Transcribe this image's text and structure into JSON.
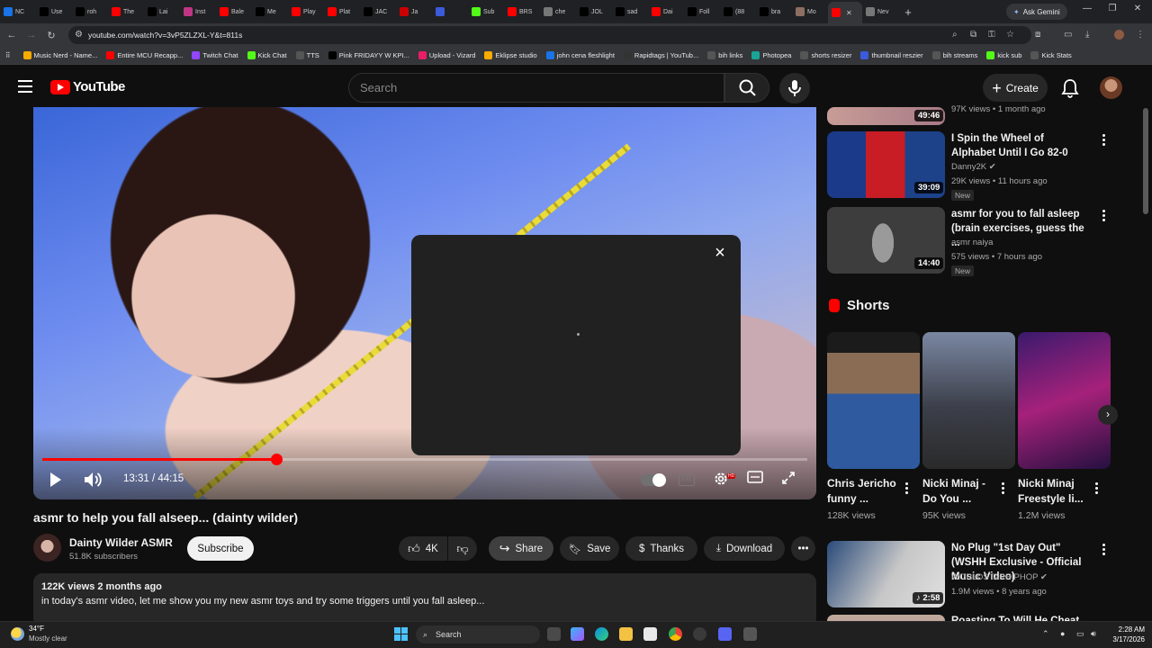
{
  "browser": {
    "tabs": [
      {
        "label": "NC",
        "color": "#1a73e8"
      },
      {
        "label": "Use",
        "color": "#000000"
      },
      {
        "label": "roh",
        "color": "#000000"
      },
      {
        "label": "The",
        "color": "#ff0000"
      },
      {
        "label": "Lai",
        "color": "#000000"
      },
      {
        "label": "Inst",
        "color": "#c13584"
      },
      {
        "label": "Bale",
        "color": "#ff0000"
      },
      {
        "label": "Me",
        "color": "#000000"
      },
      {
        "label": "Play",
        "color": "#ff0000"
      },
      {
        "label": "Plat",
        "color": "#ff0000"
      },
      {
        "label": "JAC",
        "color": "#000000"
      },
      {
        "label": "Ja",
        "color": "#cc0000"
      },
      {
        "label": "",
        "color": "#3b5bdb"
      },
      {
        "label": "Sub",
        "color": "#53fc18"
      },
      {
        "label": "BRS",
        "color": "#ff0000"
      },
      {
        "label": "che",
        "color": "#777777"
      },
      {
        "label": "JOL",
        "color": "#000000"
      },
      {
        "label": "sad",
        "color": "#000000"
      },
      {
        "label": "Dai",
        "color": "#ff0000"
      },
      {
        "label": "Foll",
        "color": "#000000"
      },
      {
        "label": "(88",
        "color": "#000000"
      },
      {
        "label": "bra",
        "color": "#000000"
      },
      {
        "label": "Mo",
        "color": "#8d6e63"
      },
      {
        "label": "",
        "color": "#ff0000"
      },
      {
        "label": "Nev",
        "color": "#777777"
      }
    ],
    "ask_gemini": "Ask Gemini",
    "url": "youtube.com/watch?v=3vP5ZLZXL-Y&t=811s",
    "bookmarks": [
      {
        "label": "Music Nerd - Name...",
        "color": "#f9ab00"
      },
      {
        "label": "Entire MCU Recapp...",
        "color": "#ff0000"
      },
      {
        "label": "Twitch Chat",
        "color": "#9146ff"
      },
      {
        "label": "Kick Chat",
        "color": "#53fc18"
      },
      {
        "label": "TTS",
        "color": "#555555"
      },
      {
        "label": "Pink FRIDAYY W KPI...",
        "color": "#000000"
      },
      {
        "label": "Upload - Vizard",
        "color": "#e91e63"
      },
      {
        "label": "Eklipse studio",
        "color": "#f9ab00"
      },
      {
        "label": "john cena fleshlight",
        "color": "#1a73e8"
      },
      {
        "label": "Rapidtags | YouTub...",
        "color": "#333333"
      },
      {
        "label": "bih links",
        "color": "#555555"
      },
      {
        "label": "Photopea",
        "color": "#18a497"
      },
      {
        "label": "shorts resizer",
        "color": "#555555"
      },
      {
        "label": "thumbnail reszier",
        "color": "#3b5bdb"
      },
      {
        "label": "bih streams",
        "color": "#555555"
      },
      {
        "label": "kick sub",
        "color": "#53fc18"
      },
      {
        "label": "Kick Stats",
        "color": "#555555"
      }
    ]
  },
  "youtube": {
    "logo": "YouTube",
    "search_placeholder": "Search",
    "create_label": "Create",
    "accent": "#ff0000"
  },
  "player": {
    "time": "13:31 / 44:15",
    "progress_fraction": 0.3057,
    "modal_close": "×"
  },
  "video": {
    "title": "asmr to help you fall alseep... (dainty wilder)",
    "channel": "Dainty Wilder ASMR",
    "subscribers": "51.8K subscribers",
    "subscribe_label": "Subscribe",
    "likes": "4K",
    "share_label": "Share",
    "save_label": "Save",
    "thanks_label": "Thanks",
    "download_label": "Download",
    "views_date": "122K views  2 months ago",
    "description": "in today's asmr video, let me show you my new asmr toys and try some triggers until you fall asleep..."
  },
  "sidebar": {
    "partial": {
      "duration": "49:46",
      "meta": "97K views • 1 month ago"
    },
    "recs": [
      {
        "title": "I Spin the Wheel of Alphabet Until I Go 82-0",
        "channel": "Danny2K",
        "meta": "29K views • 11 hours ago",
        "badge": "New",
        "duration": "39:09"
      },
      {
        "title": "asmr for you to fall asleep (brain exercises, guess the ...",
        "channel": "asmr naiya",
        "meta": "575 views • 7 hours ago",
        "badge": "New",
        "duration": "14:40"
      }
    ],
    "shorts_heading": "Shorts",
    "shorts": [
      {
        "title": "Chris Jericho funny ...",
        "views": "128K views"
      },
      {
        "title": "Nicki Minaj - Do You ...",
        "views": "95K views"
      },
      {
        "title": "Nicki Minaj Freestyle li...",
        "views": "1.2M views"
      }
    ],
    "rec3": {
      "title": "No Plug \"1st Day Out\" (WSHH Exclusive - Official Music Video)",
      "channel": "WORLDSTARHIPHOP",
      "meta": "1.9M views • 8 years ago",
      "duration": "2:58"
    },
    "rec4_title": "Roasting To Will He Cheat Again"
  },
  "taskbar": {
    "temp": "34°F",
    "weather": "Mostly clear",
    "search": "Search",
    "time": "2:28 AM",
    "date": "3/17/2026"
  }
}
